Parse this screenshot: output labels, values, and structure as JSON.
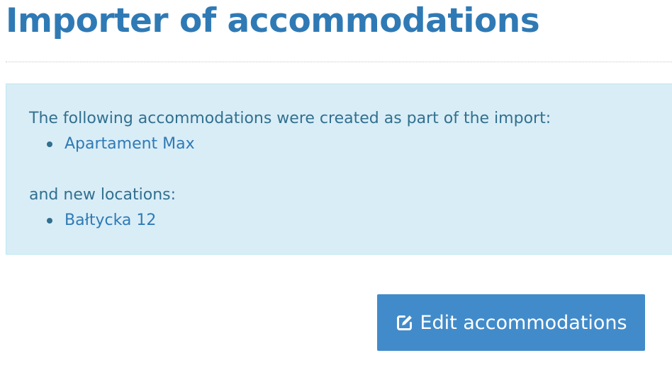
{
  "page": {
    "title": "Importer of accommodations"
  },
  "info_box": {
    "accommodations_intro": "The following accommodations were created as part of the import:",
    "accommodations": [
      "Apartament Max"
    ],
    "locations_intro": "and new locations:",
    "locations": [
      "Bałtycka 12"
    ]
  },
  "actions": {
    "edit_button_label": "Edit accommodations",
    "edit_button_icon": "edit-icon"
  },
  "colors": {
    "title": "#2f7ab5",
    "info_bg": "#d9edf7",
    "info_border": "#bce8f1",
    "info_text": "#31708f",
    "link": "#2f7ab5",
    "button_bg": "#428bca"
  }
}
